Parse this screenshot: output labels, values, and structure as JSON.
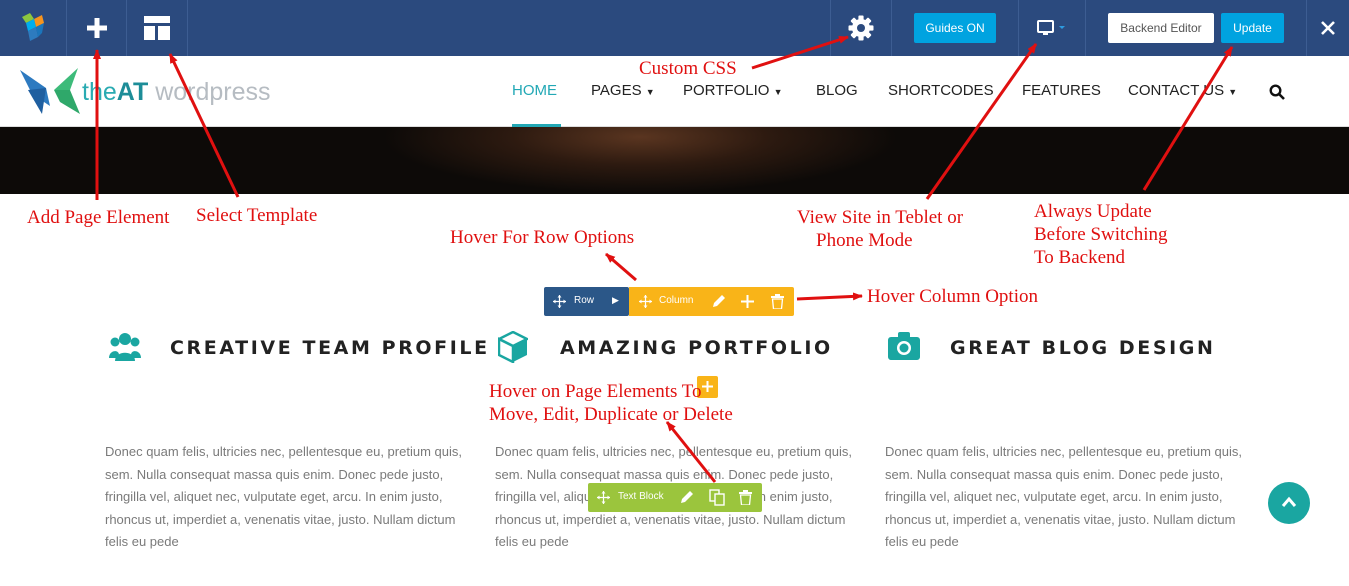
{
  "toolbar": {
    "logo_icon": "vc-cube-logo-icon",
    "add_icon": "plus-icon",
    "template_icon": "layout-template-icon",
    "settings_icon": "gear-icon",
    "guides_label": "Guides ON",
    "device_icon": "monitor-icon",
    "backend_label": "Backend Editor",
    "update_label": "Update",
    "close_icon": "close-icon",
    "colors": {
      "bar": "#2b4a7e",
      "guides": "#00a3e0",
      "update": "#00a3e0"
    }
  },
  "site": {
    "logo": {
      "part1": "the",
      "part2": "AT",
      "part3": " wordpress"
    },
    "nav": [
      "HOME",
      "PAGES",
      "PORTFOLIO",
      "BLOG",
      "SHORTCODES",
      "FEATURES",
      "CONTACT US"
    ],
    "active_nav": "HOME",
    "accent": "#22a8b5"
  },
  "controls": {
    "row_label": "Row",
    "column_label": "Column",
    "text_block_label": "Text Block"
  },
  "features": [
    {
      "icon": "users-icon",
      "title": "CREATIVE TEAM PROFILE",
      "body": "Donec quam felis, ultricies nec, pellentesque eu, pretium quis, sem. Nulla consequat massa quis enim. Donec pede justo, fringilla vel, aliquet nec, vulputate eget, arcu. In enim justo, rhoncus ut, imperdiet a, venenatis vitae, justo. Nullam dictum felis eu pede"
    },
    {
      "icon": "cube-icon",
      "title": "AMAZING PORTFOLIO",
      "body": "Donec quam felis, ultricies nec, pellentesque eu, pretium quis, sem. Nulla consequat massa quis enim. Donec pede justo, fringilla vel, aliquet nec, vulputate eget, arcu. In enim justo, rhoncus ut, imperdiet a, venenatis vitae, justo. Nullam dictum felis eu pede"
    },
    {
      "icon": "camera-icon",
      "title": "GREAT BLOG DESIGN",
      "body": "Donec quam felis, ultricies nec, pellentesque eu, pretium quis, sem. Nulla consequat massa quis enim. Donec pede justo, fringilla vel, aliquet nec, vulputate eget, arcu. In enim justo, rhoncus ut, imperdiet a, venenatis vitae, justo. Nullam dictum felis eu pede"
    }
  ],
  "annotations": {
    "custom_css": "Custom CSS",
    "add_element": "Add Page Element",
    "select_template": "Select Template",
    "view_mode_1": "View Site in Teblet or",
    "view_mode_2": "Phone Mode",
    "update_1": "Always Update",
    "update_2": "Before Switching",
    "update_3": "To Backend",
    "row_options": "Hover For Row Options",
    "column_option": "Hover Column Option",
    "elements_1": "Hover on Page Elements To",
    "elements_2": "Move, Edit, Duplicate or Delete"
  }
}
